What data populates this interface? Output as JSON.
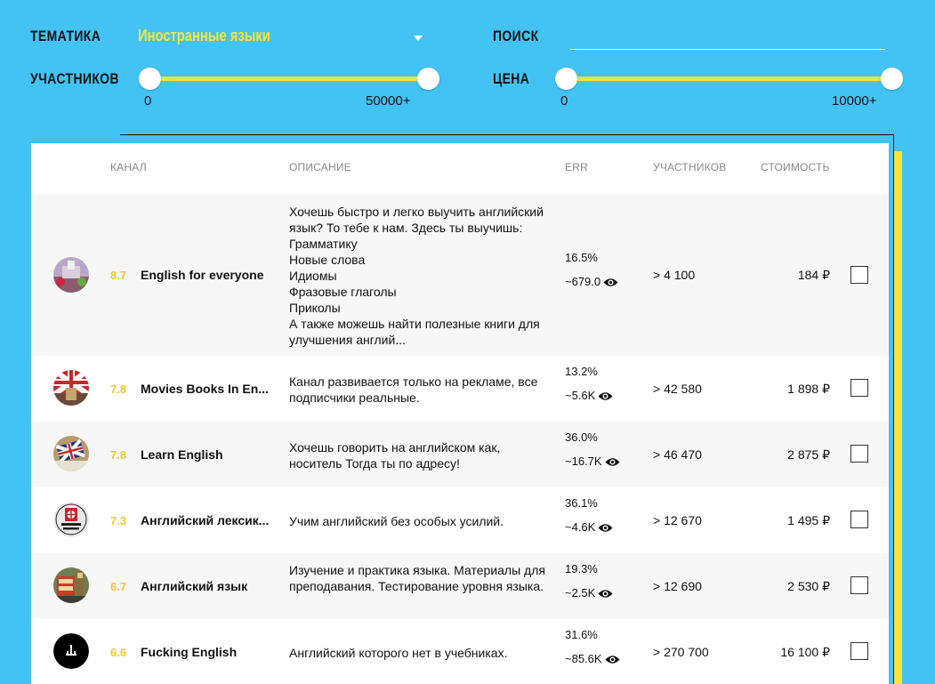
{
  "filters": {
    "topic_label": "ТЕМАТИКА",
    "topic_value": "Иностранные языки",
    "search_label": "ПОИСК",
    "search_value": "",
    "members_label": "УЧАСТНИКОВ",
    "members_min": "0",
    "members_max": "50000+",
    "price_label": "ЦЕНА",
    "price_min": "0",
    "price_max": "10000+"
  },
  "table": {
    "headers": {
      "channel": "КАНАЛ",
      "description": "ОПИСАНИЕ",
      "err": "ERR",
      "members": "УЧАСТНИКОВ",
      "price": "СТОИМОСТЬ"
    },
    "rows": [
      {
        "rating": "8.7",
        "name": "English for everyone",
        "description": "Хочешь быстро и легко выучить английский язык? То тебе к нам. Здесь ты выучишь: Грамматику\nНовые слова\nИдиомы\nФразовые глаголы\nПриколы\nА также можешь найти полезные книги для улучшения англий...",
        "err": "16.5%",
        "views": "~679.0",
        "members": "> 4 100",
        "price": "184 ₽",
        "avatar": "city-avatar-icon"
      },
      {
        "rating": "7.8",
        "name": "Movies Books In En...",
        "description": "Канал развивается только на рекламе, все подписчики реальные.",
        "err": "13.2%",
        "views": "~5.6K",
        "members": "> 42 580",
        "price": "1 898 ₽",
        "avatar": "uk-flag-avatar-icon"
      },
      {
        "rating": "7.8",
        "name": "Learn English",
        "description": "Хочешь говорить на английском как, носитель Тогда ты по адресу!",
        "err": "36.0%",
        "views": "~16.7K",
        "members": "> 46 470",
        "price": "2 875 ₽",
        "avatar": "uk-flag-book-avatar-icon"
      },
      {
        "rating": "7.3",
        "name": "Английский лексик...",
        "description": "Учим английский без особых усилий.",
        "err": "36.1%",
        "views": "~4.6K",
        "members": "> 12 670",
        "price": "1 495 ₽",
        "avatar": "lexicon-logo-avatar-icon"
      },
      {
        "rating": "6.7",
        "name": "Английский язык",
        "description": "Изучение и практика языка. Материалы для преподавания. Тестирование уровня языка.",
        "err": "19.3%",
        "views": "~2.5K",
        "members": "> 12 690",
        "price": "2 530 ₽",
        "avatar": "london-bus-avatar-icon"
      },
      {
        "rating": "6.6",
        "name": "Fucking English",
        "description": "Английский которого нет в учебниках.",
        "err": "31.6%",
        "views": "~85.6K",
        "members": "> 270 700",
        "price": "16 100 ₽",
        "avatar": "black-logo-avatar-icon"
      }
    ]
  },
  "colors": {
    "background": "#43c3f4",
    "accent_yellow": "#f6e53b",
    "rating": "#f3c437"
  }
}
